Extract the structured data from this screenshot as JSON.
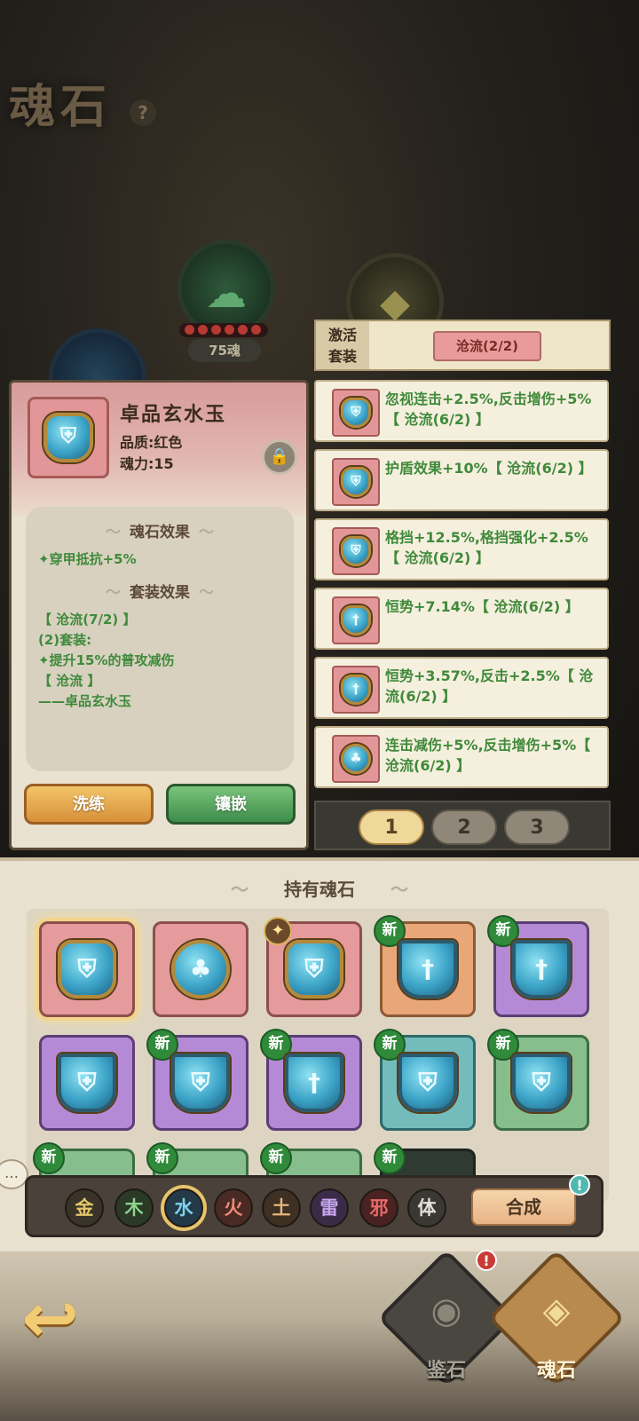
{
  "header": {
    "title": "魂石",
    "help": "?"
  },
  "background": {
    "orb_label": "75魂"
  },
  "detail": {
    "name": "卓品玄水玉",
    "quality": "品质:红色",
    "power": "魂力:15",
    "lock_icon": "lock-icon",
    "stone_effect_title": "魂石效果",
    "stone_effect": "✦穿甲抵抗+5%",
    "set_effect_title": "套装效果",
    "set_lines": [
      "【 沧流(7/2) 】",
      "(2)套装:",
      "✦提升15%的普攻减伤",
      "【 沧流 】",
      "——卓品玄水玉"
    ],
    "buttons": {
      "refine": "洗练",
      "inlay": "镶嵌"
    }
  },
  "set_panel": {
    "label": "激活\n套装",
    "active_set": "沧流(2/2)",
    "items": [
      {
        "text": "忽视连击+2.5%,反击增伤+5%【 沧流(6/2) 】",
        "glyph": "⛨"
      },
      {
        "text": "护盾效果+10%【 沧流(6/2) 】",
        "glyph": "⛨"
      },
      {
        "text": "格挡+12.5%,格挡强化+2.5%【 沧流(6/2) 】",
        "glyph": "⛨"
      },
      {
        "text": "恒势+7.14%【 沧流(6/2) 】",
        "glyph": "†"
      },
      {
        "text": "恒势+3.57%,反击+2.5%【 沧流(6/2) 】",
        "glyph": "†"
      },
      {
        "text": "连击减伤+5%,反击增伤+5%【 沧流(6/2) 】",
        "glyph": "♣"
      }
    ],
    "pages": [
      "1",
      "2",
      "3"
    ],
    "active_page": "1"
  },
  "inventory": {
    "title": "持有魂石",
    "new_label": "新",
    "elements": [
      {
        "label": "金",
        "color": "#e3c76a",
        "bg": "#3a3328"
      },
      {
        "label": "木",
        "color": "#8fd48c",
        "bg": "#2a3a27"
      },
      {
        "label": "水",
        "color": "#7fd1ec",
        "bg": "#243a48"
      },
      {
        "label": "火",
        "color": "#f08a78",
        "bg": "#4a2a24"
      },
      {
        "label": "土",
        "color": "#e7b57a",
        "bg": "#3e3022"
      },
      {
        "label": "雷",
        "color": "#c8a6ee",
        "bg": "#3a2c48"
      },
      {
        "label": "邪",
        "color": "#ea6a66",
        "bg": "#4a2222"
      },
      {
        "label": "体",
        "color": "#e4e0d8",
        "bg": "#3a3833"
      }
    ],
    "active_element": "水",
    "synthesize": "合成",
    "synthesize_alert": "!"
  },
  "nav": {
    "appraise": "鉴石",
    "soul": "魂石",
    "appraise_alert": "!"
  },
  "colors": {
    "green_text": "#3f8a3a",
    "accent_gold": "#f0d79a"
  }
}
